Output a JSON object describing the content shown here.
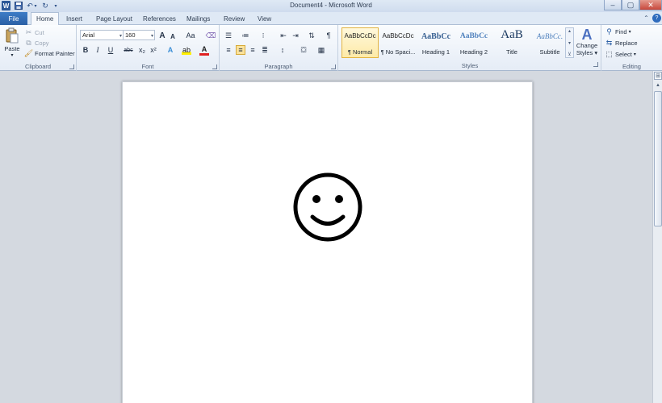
{
  "window": {
    "title": "Document4  -  Microsoft Word",
    "app_icon": "W",
    "controls": [
      "–",
      "▢",
      "✕"
    ]
  },
  "qat": {
    "save": "save-icon",
    "undo": "undo-icon",
    "redo": "redo-icon",
    "customize": "dropdown-icon"
  },
  "tabs": {
    "file": "File",
    "items": [
      "Home",
      "Insert",
      "Page Layout",
      "References",
      "Mailings",
      "Review",
      "View"
    ],
    "active": "Home"
  },
  "ribbon": {
    "clipboard": {
      "label": "Clipboard",
      "paste": "Paste",
      "cut": "Cut",
      "copy": "Copy",
      "format_painter": "Format Painter"
    },
    "font": {
      "label": "Font",
      "font_name": "Arial",
      "font_size": "160",
      "grow": "A",
      "shrink": "A",
      "change_case": "Aa",
      "bold": "B",
      "italic": "I",
      "underline": "U",
      "strike": "abc",
      "subscript": "x₂",
      "superscript": "x²",
      "text_effects": "A",
      "font_color": "A"
    },
    "paragraph": {
      "label": "Paragraph",
      "show_marks": "¶"
    },
    "styles": {
      "label": "Styles",
      "items": [
        {
          "preview": "AaBbCcDc",
          "name": "¶ Normal"
        },
        {
          "preview": "AaBbCcDc",
          "name": "¶ No Spaci..."
        },
        {
          "preview": "AaBbCc",
          "name": "Heading 1"
        },
        {
          "preview": "AaBbCc",
          "name": "Heading 2"
        },
        {
          "preview": "AaB",
          "name": "Title"
        },
        {
          "preview": "AaBbCc.",
          "name": "Subtitle"
        }
      ],
      "change_styles": "Change Styles",
      "change_styles_line1": "Change",
      "change_styles_line2": "Styles ▾"
    },
    "editing": {
      "label": "Editing",
      "find": "Find",
      "replace": "Replace",
      "select": "Select"
    }
  },
  "document": {
    "content": "smiley-face",
    "glyph": "☺"
  },
  "colors": {
    "file_tab": "#2a5fa5",
    "accent": "#2b5797",
    "highlight": "#fdeaa8"
  }
}
